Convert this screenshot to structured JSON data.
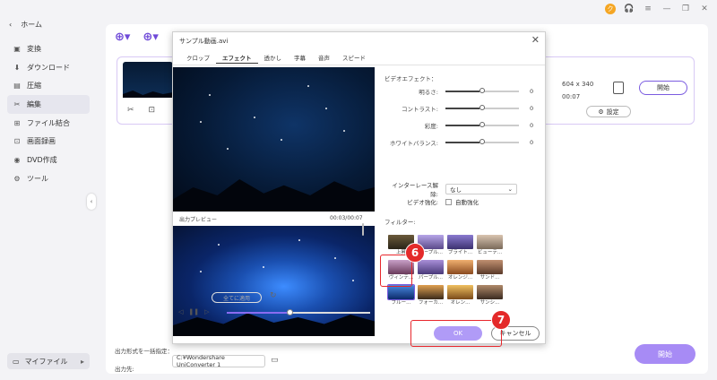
{
  "window": {
    "avatar": "ク",
    "controls": [
      "🎧",
      "≡",
      "—",
      "❐",
      "✕"
    ]
  },
  "sidebar": {
    "home": "ホーム",
    "items": [
      {
        "label": "変換",
        "icon": "▣"
      },
      {
        "label": "ダウンロード",
        "icon": "⬇"
      },
      {
        "label": "圧縮",
        "icon": "▤"
      },
      {
        "label": "編集",
        "icon": "✂"
      },
      {
        "label": "ファイル結合",
        "icon": "⊞"
      },
      {
        "label": "画面録画",
        "icon": "⊡"
      },
      {
        "label": "DVD作成",
        "icon": "◉"
      },
      {
        "label": "ツール",
        "icon": "⚙"
      }
    ],
    "myfile": "マイファイル",
    "myfile_arrow": "▸"
  },
  "card": {
    "resolution": "604 x 340",
    "duration": "00:07",
    "start_small": "開始",
    "settings": "設定"
  },
  "bottom": {
    "format_label": "出力形式を一括指定：",
    "output_label": "出力先:",
    "output_path": "C:¥Wondershare UniConverter 1",
    "start": "開始"
  },
  "dialog": {
    "title": "サンプル動画.avi",
    "tabs": [
      "クロップ",
      "エフェクト",
      "透かし",
      "字幕",
      "音声",
      "スピード"
    ],
    "preview_label": "出力プレビュー",
    "preview_time": "00:03/00:07",
    "video_effect_title": "ビデオエフェクト：",
    "sliders": [
      {
        "label": "明るさ:",
        "value": "0"
      },
      {
        "label": "コントラスト:",
        "value": "0"
      },
      {
        "label": "彩度:",
        "value": "0"
      },
      {
        "label": "ホワイトバランス:",
        "value": "0"
      }
    ],
    "interlace_label": "インターレース解除:",
    "interlace_value": "なし",
    "enhance_label": "ビデオ強化:",
    "enhance_option": "自動強化",
    "filter_title": "フィルター:",
    "filters": [
      [
        "上昇",
        "パープル...",
        "ブライト...",
        "ビューテ..."
      ],
      [
        "ヴィンテ...",
        "パープル...",
        "オレンジ...",
        "サンド..."
      ],
      [
        "ブルー...",
        "フォーカ...",
        "オレン...",
        "サンシ..."
      ]
    ],
    "apply_all": "全てに適用",
    "ok": "OK",
    "cancel": "キャンセル"
  },
  "steps": {
    "six": "6",
    "seven": "7"
  }
}
